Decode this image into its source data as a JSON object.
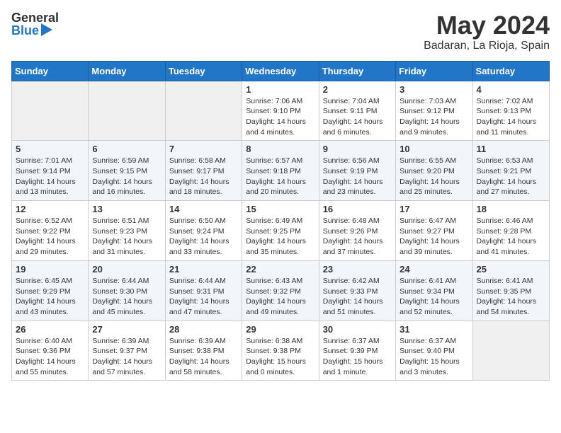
{
  "header": {
    "logo_general": "General",
    "logo_blue": "Blue",
    "month": "May 2024",
    "location": "Badaran, La Rioja, Spain"
  },
  "weekdays": [
    "Sunday",
    "Monday",
    "Tuesday",
    "Wednesday",
    "Thursday",
    "Friday",
    "Saturday"
  ],
  "weeks": [
    [
      {
        "day": null
      },
      {
        "day": null
      },
      {
        "day": null
      },
      {
        "day": "1",
        "sunrise": "Sunrise: 7:06 AM",
        "sunset": "Sunset: 9:10 PM",
        "daylight": "Daylight: 14 hours and 4 minutes."
      },
      {
        "day": "2",
        "sunrise": "Sunrise: 7:04 AM",
        "sunset": "Sunset: 9:11 PM",
        "daylight": "Daylight: 14 hours and 6 minutes."
      },
      {
        "day": "3",
        "sunrise": "Sunrise: 7:03 AM",
        "sunset": "Sunset: 9:12 PM",
        "daylight": "Daylight: 14 hours and 9 minutes."
      },
      {
        "day": "4",
        "sunrise": "Sunrise: 7:02 AM",
        "sunset": "Sunset: 9:13 PM",
        "daylight": "Daylight: 14 hours and 11 minutes."
      }
    ],
    [
      {
        "day": "5",
        "sunrise": "Sunrise: 7:01 AM",
        "sunset": "Sunset: 9:14 PM",
        "daylight": "Daylight: 14 hours and 13 minutes."
      },
      {
        "day": "6",
        "sunrise": "Sunrise: 6:59 AM",
        "sunset": "Sunset: 9:15 PM",
        "daylight": "Daylight: 14 hours and 16 minutes."
      },
      {
        "day": "7",
        "sunrise": "Sunrise: 6:58 AM",
        "sunset": "Sunset: 9:17 PM",
        "daylight": "Daylight: 14 hours and 18 minutes."
      },
      {
        "day": "8",
        "sunrise": "Sunrise: 6:57 AM",
        "sunset": "Sunset: 9:18 PM",
        "daylight": "Daylight: 14 hours and 20 minutes."
      },
      {
        "day": "9",
        "sunrise": "Sunrise: 6:56 AM",
        "sunset": "Sunset: 9:19 PM",
        "daylight": "Daylight: 14 hours and 23 minutes."
      },
      {
        "day": "10",
        "sunrise": "Sunrise: 6:55 AM",
        "sunset": "Sunset: 9:20 PM",
        "daylight": "Daylight: 14 hours and 25 minutes."
      },
      {
        "day": "11",
        "sunrise": "Sunrise: 6:53 AM",
        "sunset": "Sunset: 9:21 PM",
        "daylight": "Daylight: 14 hours and 27 minutes."
      }
    ],
    [
      {
        "day": "12",
        "sunrise": "Sunrise: 6:52 AM",
        "sunset": "Sunset: 9:22 PM",
        "daylight": "Daylight: 14 hours and 29 minutes."
      },
      {
        "day": "13",
        "sunrise": "Sunrise: 6:51 AM",
        "sunset": "Sunset: 9:23 PM",
        "daylight": "Daylight: 14 hours and 31 minutes."
      },
      {
        "day": "14",
        "sunrise": "Sunrise: 6:50 AM",
        "sunset": "Sunset: 9:24 PM",
        "daylight": "Daylight: 14 hours and 33 minutes."
      },
      {
        "day": "15",
        "sunrise": "Sunrise: 6:49 AM",
        "sunset": "Sunset: 9:25 PM",
        "daylight": "Daylight: 14 hours and 35 minutes."
      },
      {
        "day": "16",
        "sunrise": "Sunrise: 6:48 AM",
        "sunset": "Sunset: 9:26 PM",
        "daylight": "Daylight: 14 hours and 37 minutes."
      },
      {
        "day": "17",
        "sunrise": "Sunrise: 6:47 AM",
        "sunset": "Sunset: 9:27 PM",
        "daylight": "Daylight: 14 hours and 39 minutes."
      },
      {
        "day": "18",
        "sunrise": "Sunrise: 6:46 AM",
        "sunset": "Sunset: 9:28 PM",
        "daylight": "Daylight: 14 hours and 41 minutes."
      }
    ],
    [
      {
        "day": "19",
        "sunrise": "Sunrise: 6:45 AM",
        "sunset": "Sunset: 9:29 PM",
        "daylight": "Daylight: 14 hours and 43 minutes."
      },
      {
        "day": "20",
        "sunrise": "Sunrise: 6:44 AM",
        "sunset": "Sunset: 9:30 PM",
        "daylight": "Daylight: 14 hours and 45 minutes."
      },
      {
        "day": "21",
        "sunrise": "Sunrise: 6:44 AM",
        "sunset": "Sunset: 9:31 PM",
        "daylight": "Daylight: 14 hours and 47 minutes."
      },
      {
        "day": "22",
        "sunrise": "Sunrise: 6:43 AM",
        "sunset": "Sunset: 9:32 PM",
        "daylight": "Daylight: 14 hours and 49 minutes."
      },
      {
        "day": "23",
        "sunrise": "Sunrise: 6:42 AM",
        "sunset": "Sunset: 9:33 PM",
        "daylight": "Daylight: 14 hours and 51 minutes."
      },
      {
        "day": "24",
        "sunrise": "Sunrise: 6:41 AM",
        "sunset": "Sunset: 9:34 PM",
        "daylight": "Daylight: 14 hours and 52 minutes."
      },
      {
        "day": "25",
        "sunrise": "Sunrise: 6:41 AM",
        "sunset": "Sunset: 9:35 PM",
        "daylight": "Daylight: 14 hours and 54 minutes."
      }
    ],
    [
      {
        "day": "26",
        "sunrise": "Sunrise: 6:40 AM",
        "sunset": "Sunset: 9:36 PM",
        "daylight": "Daylight: 14 hours and 55 minutes."
      },
      {
        "day": "27",
        "sunrise": "Sunrise: 6:39 AM",
        "sunset": "Sunset: 9:37 PM",
        "daylight": "Daylight: 14 hours and 57 minutes."
      },
      {
        "day": "28",
        "sunrise": "Sunrise: 6:39 AM",
        "sunset": "Sunset: 9:38 PM",
        "daylight": "Daylight: 14 hours and 58 minutes."
      },
      {
        "day": "29",
        "sunrise": "Sunrise: 6:38 AM",
        "sunset": "Sunset: 9:38 PM",
        "daylight": "Daylight: 15 hours and 0 minutes."
      },
      {
        "day": "30",
        "sunrise": "Sunrise: 6:37 AM",
        "sunset": "Sunset: 9:39 PM",
        "daylight": "Daylight: 15 hours and 1 minute."
      },
      {
        "day": "31",
        "sunrise": "Sunrise: 6:37 AM",
        "sunset": "Sunset: 9:40 PM",
        "daylight": "Daylight: 15 hours and 3 minutes."
      },
      {
        "day": null
      }
    ]
  ]
}
